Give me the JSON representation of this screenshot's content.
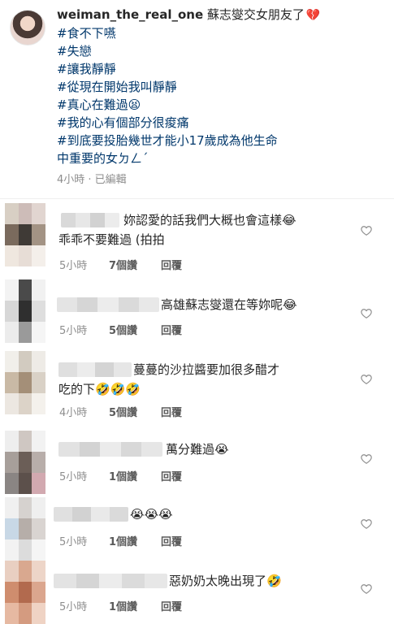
{
  "caption": {
    "username": "weiman_the_real_one",
    "text": "蘇志燮交女朋友了",
    "heart_emoji": "💔",
    "lines": [
      "#食不下嚥",
      "#失戀",
      "#讓我靜靜",
      "#從現在開始我叫靜靜",
      "#真心在難過😫",
      "#我的心有個部分很痠痛",
      "#到底要投胎幾世才能小17歲成為他生命",
      "中重要的女ㄉㄥˊ"
    ],
    "meta": "4小時 · 已編輯"
  },
  "comments": [
    {
      "line1": "妳認愛的話我們大概也會這樣😂",
      "line2": "乖乖不要難過 (拍拍",
      "time": "5小時",
      "likes": "7個讚",
      "reply": "回覆"
    },
    {
      "line1": "高雄蘇志燮還在等妳呢😂",
      "line2": "",
      "time": "5小時",
      "likes": "5個讚",
      "reply": "回覆"
    },
    {
      "line1": "蔓蔓的沙拉醬要加很多醋才",
      "line2": "吃的下🤣🤣🤣",
      "time": "4小時",
      "likes": "5個讚",
      "reply": "回覆"
    },
    {
      "line1": "萬分難過😭",
      "line2": "",
      "time": "5小時",
      "likes": "1個讚",
      "reply": "回覆"
    },
    {
      "line1": "😭😭😭",
      "line2": "",
      "time": "5小時",
      "likes": "1個讚",
      "reply": "回覆"
    },
    {
      "line1": "惡奶奶太晚出現了🤣",
      "line2": "",
      "time": "5小時",
      "likes": "1個讚",
      "reply": "回覆"
    }
  ],
  "icons": {
    "like": "heart-outline-icon"
  },
  "colors": {
    "hashtag": "#00376b",
    "meta": "#8e8e8e"
  }
}
